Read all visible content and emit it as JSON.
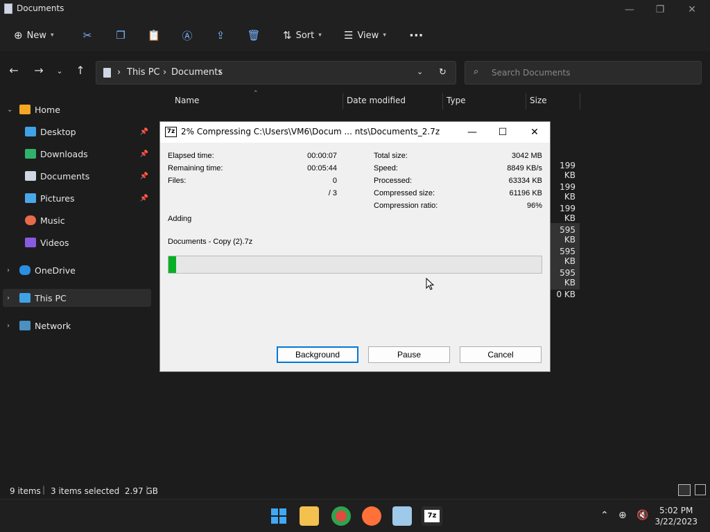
{
  "window": {
    "title": "Documents",
    "minimize": "—",
    "maximize": "❐",
    "close": "✕"
  },
  "toolbar": {
    "new_label": "New",
    "sort_label": "Sort",
    "view_label": "View",
    "more": "···"
  },
  "address": {
    "pc": "This PC",
    "folder": "Documents",
    "sep": "›"
  },
  "search": {
    "placeholder": "Search Documents"
  },
  "sidebar": {
    "home": "Home",
    "items": [
      {
        "label": "Desktop"
      },
      {
        "label": "Downloads"
      },
      {
        "label": "Documents"
      },
      {
        "label": "Pictures"
      },
      {
        "label": "Music"
      },
      {
        "label": "Videos"
      }
    ],
    "onedrive": "OneDrive",
    "thispc": "This PC",
    "network": "Network"
  },
  "columns": {
    "name": "Name",
    "date": "Date modified",
    "type": "Type",
    "size": "Size"
  },
  "sizes": [
    "199 KB",
    "199 KB",
    "199 KB",
    "595 KB",
    "595 KB",
    "595 KB",
    "0 KB"
  ],
  "status": {
    "items": "9 items",
    "selected": "3 items selected  2.97 GB"
  },
  "dialog": {
    "title": "2% Compressing C:\\Users\\VM6\\Docum ... nts\\Documents_2.7z",
    "icon": "7z",
    "left_labels": [
      "Elapsed time:",
      "Remaining time:",
      "Files:"
    ],
    "left_values": [
      "00:00:07",
      "00:05:44",
      "0",
      "/ 3"
    ],
    "right_labels": [
      "Total size:",
      "Speed:",
      "Processed:",
      "Compressed size:",
      "Compression ratio:"
    ],
    "right_values": [
      "3042 MB",
      "8849 KB/s",
      "63334 KB",
      "61196 KB",
      "96%"
    ],
    "action": "Adding",
    "file": "Documents - Copy (2).7z",
    "progress": 0.02,
    "buttons": {
      "background": "Background",
      "pause": "Pause",
      "cancel": "Cancel"
    }
  },
  "clock": {
    "time": "5:02 PM",
    "date": "3/22/2023"
  }
}
